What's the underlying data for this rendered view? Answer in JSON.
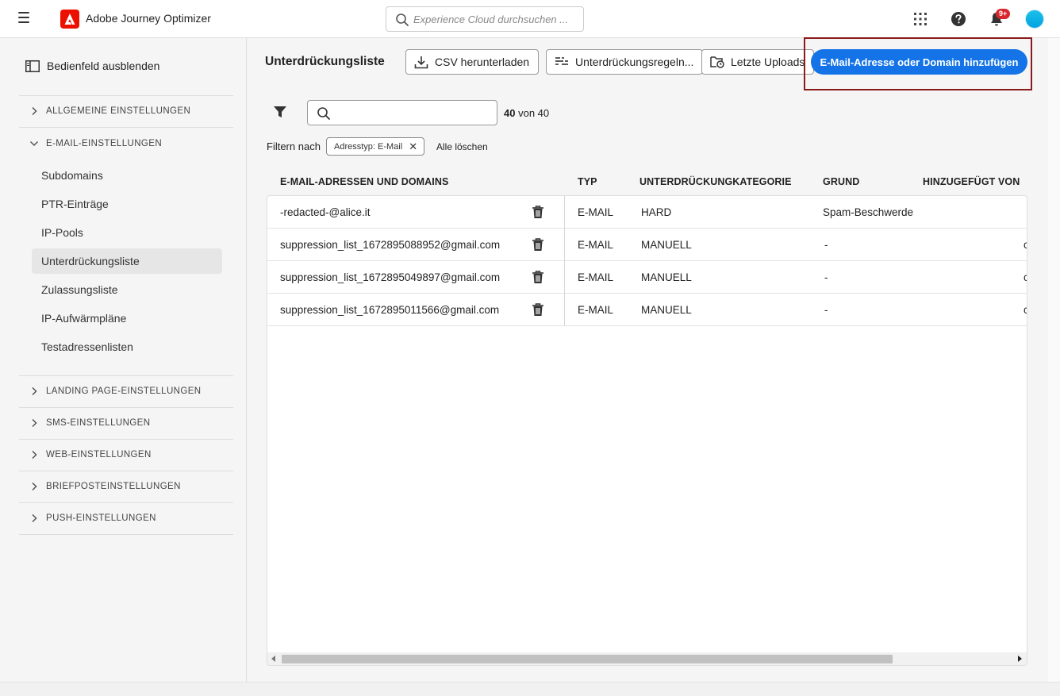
{
  "topbar": {
    "app_title": "Adobe Journey Optimizer",
    "search_placeholder": "Experience Cloud durchsuchen ...",
    "notification_badge": "9+"
  },
  "sidebar": {
    "hide_label": "Bedienfeld ausblenden",
    "sections": [
      {
        "label": "ALLGEMEINE EINSTELLUNGEN",
        "expanded": false
      },
      {
        "label": "E-MAIL-EINSTELLUNGEN",
        "expanded": true
      },
      {
        "label": "LANDING PAGE-EINSTELLUNGEN",
        "expanded": false
      },
      {
        "label": "SMS-EINSTELLUNGEN",
        "expanded": false
      },
      {
        "label": "WEB-EINSTELLUNGEN",
        "expanded": false
      },
      {
        "label": "BRIEFPOSTEINSTELLUNGEN",
        "expanded": false
      },
      {
        "label": "PUSH-EINSTELLUNGEN",
        "expanded": false
      }
    ],
    "email_items": [
      {
        "label": "Subdomains"
      },
      {
        "label": "PTR-Einträge"
      },
      {
        "label": "IP-Pools"
      },
      {
        "label": "Unterdrückungsliste",
        "active": true
      },
      {
        "label": "Zulassungsliste"
      },
      {
        "label": "IP-Aufwärmpläne"
      },
      {
        "label": "Testadressenlisten"
      }
    ]
  },
  "main": {
    "title": "Unterdrückungsliste",
    "buttons": {
      "csv": "CSV herunterladen",
      "rules": "Unterdrückungsregeln...",
      "uploads": "Letzte Uploads",
      "add": "E-Mail-Adresse oder Domain hinzufügen"
    },
    "count_current": "40",
    "count_rest": "von 40",
    "filter_by": "Filtern nach",
    "filter_tag": "Adresstyp: E-Mail",
    "clear_all": "Alle löschen"
  },
  "table": {
    "columns": [
      "E-MAIL-ADRESSEN UND DOMAINS",
      "TYP",
      "UNTERDRÜCKUNGKATEGORIE",
      "GRUND",
      "HINZUGEFÜGT VON"
    ],
    "rows": [
      {
        "address": "-redacted-@alice.it",
        "type": "E-MAIL",
        "category": "HARD",
        "reason": "Spam-Beschwerde",
        "added_by": ""
      },
      {
        "address": "suppression_list_1672895088952@gmail.com",
        "type": "E-MAIL",
        "category": "MANUELL",
        "reason": "-",
        "added_by": "c"
      },
      {
        "address": "suppression_list_1672895049897@gmail.com",
        "type": "E-MAIL",
        "category": "MANUELL",
        "reason": "-",
        "added_by": "c"
      },
      {
        "address": "suppression_list_1672895011566@gmail.com",
        "type": "E-MAIL",
        "category": "MANUELL",
        "reason": "-",
        "added_by": "c"
      }
    ]
  },
  "colors": {
    "primary": "#1473e6",
    "adobe_red": "#eb1000",
    "highlight": "#8b1a1a",
    "badge": "#d7262d"
  }
}
